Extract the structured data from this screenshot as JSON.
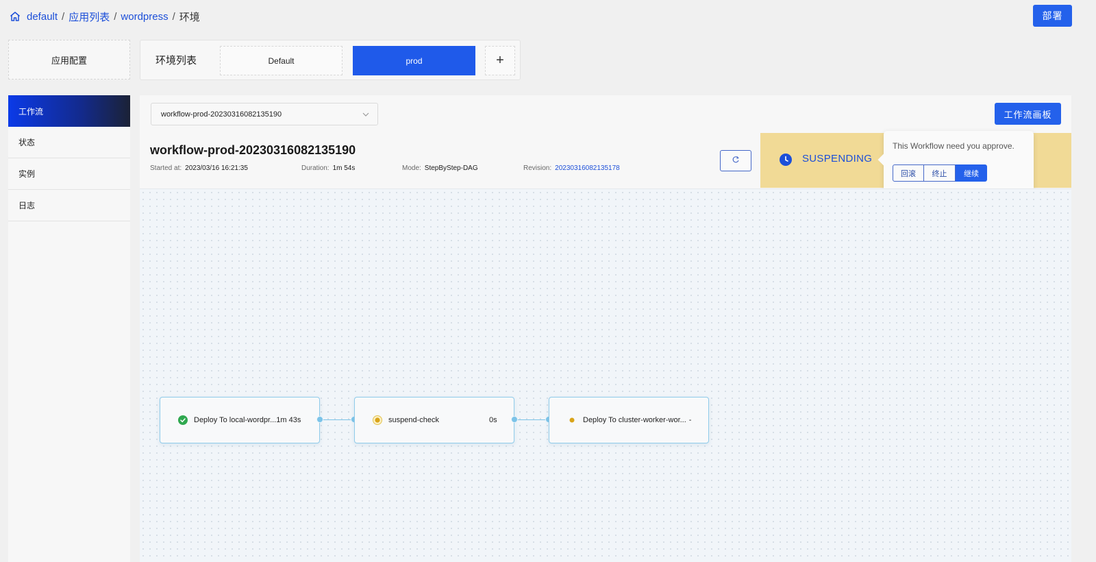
{
  "breadcrumb": {
    "home_icon": "home-icon",
    "items": [
      "default",
      "应用列表",
      "wordpress"
    ],
    "current": "环境",
    "separator": "/"
  },
  "header": {
    "deploy_label": "部署"
  },
  "top_tabs": {
    "app_config_label": "应用配置",
    "env_list_title": "环境列表",
    "envs": [
      {
        "label": "Default",
        "active": false
      },
      {
        "label": "prod",
        "active": true
      }
    ],
    "add_label": "+"
  },
  "sidebar": {
    "items": [
      {
        "label": "工作流",
        "active": true
      },
      {
        "label": "状态",
        "active": false
      },
      {
        "label": "实例",
        "active": false
      },
      {
        "label": "日志",
        "active": false
      }
    ]
  },
  "workflow": {
    "selector_value": "workflow-prod-20230316082135190",
    "board_label": "工作流画板",
    "title": "workflow-prod-20230316082135190",
    "started_label": "Started at:",
    "started_value": "2023/03/16 16:21:35",
    "duration_label": "Duration:",
    "duration_value": "1m 54s",
    "mode_label": "Mode:",
    "mode_value": "StepByStep-DAG",
    "revision_label": "Revision:",
    "revision_value": "20230316082135178",
    "status": "SUSPENDING",
    "status_color": "#f1da96",
    "popover": {
      "message": "This Workflow need you approve.",
      "rollback_label": "回滚",
      "terminate_label": "终止",
      "resume_label": "继续"
    }
  },
  "steps": [
    {
      "name": "Deploy To local-wordpr...",
      "duration": "1m 43s",
      "status": "succeeded"
    },
    {
      "name": "suspend-check",
      "duration": "0s",
      "status": "suspending"
    },
    {
      "name": "Deploy To cluster-worker-wor...",
      "duration": "-",
      "status": "pending"
    }
  ],
  "colors": {
    "primary": "#2461eb",
    "link": "#1c4fd9",
    "success": "#2fa84f",
    "warning": "#d9a419",
    "edge": "#7cc3e8"
  }
}
